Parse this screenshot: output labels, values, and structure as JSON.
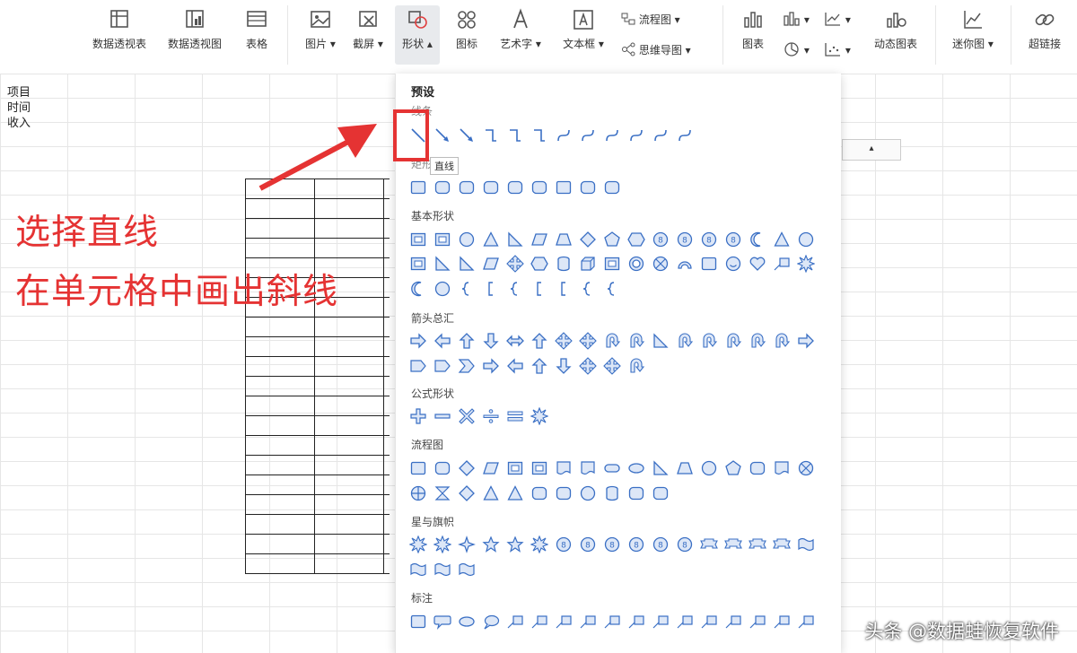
{
  "ribbon": {
    "pivot_table": "数据透视表",
    "pivot_chart": "数据透视图",
    "table": "表格",
    "picture": "图片",
    "screenshot": "截屏",
    "shapes": "形状",
    "icons": "图标",
    "wordart": "艺术字",
    "textbox": "文本框",
    "flowchart": "流程图",
    "mindmap": "思维导图",
    "chart": "图表",
    "dynamic_chart": "动态图表",
    "sparkline": "迷你图",
    "hyperlink": "超链接"
  },
  "sheet": {
    "row_labels": [
      "项目",
      "时间",
      "收入"
    ]
  },
  "annotation": {
    "line1": "选择直线",
    "line2": "在单元格中画出斜线"
  },
  "panel": {
    "title": "预设",
    "tooltip": "直线",
    "sections": {
      "lines": "线条",
      "rectangles": "矩形",
      "basic": "基本形状",
      "arrows": "箭头总汇",
      "equations": "公式形状",
      "flowchart": "流程图",
      "stars": "星与旗帜",
      "callouts": "标注"
    }
  },
  "watermark": "头条 @数据蛙恢复软件",
  "colors": {
    "accent_red": "#e53333",
    "shape_blue": "#3a6fc4",
    "shape_fill": "#dde7f7"
  }
}
